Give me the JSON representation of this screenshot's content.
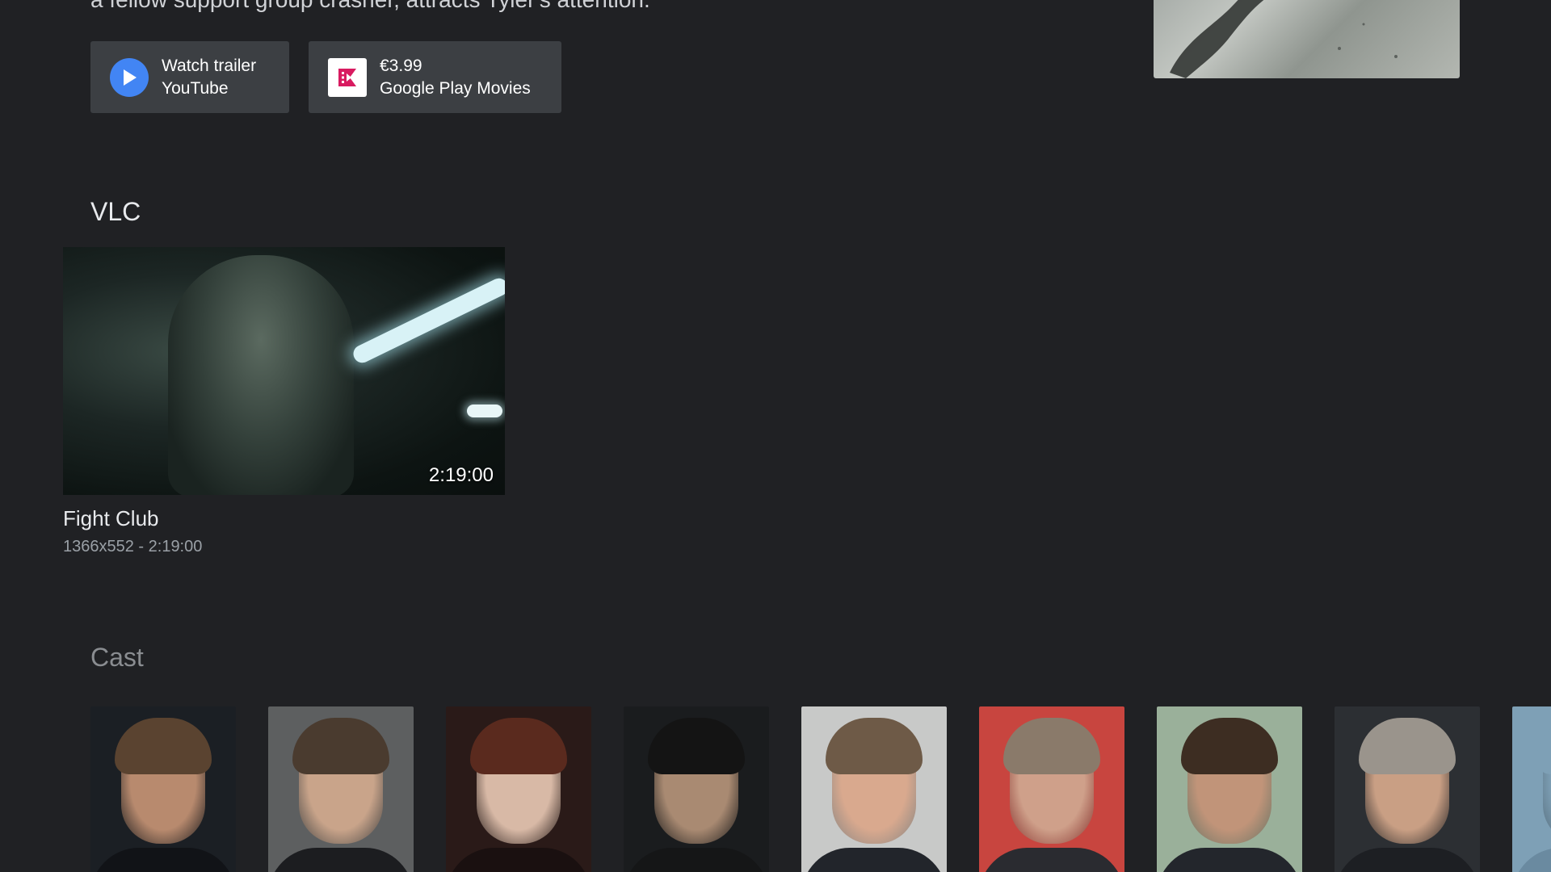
{
  "overview": {
    "synopsis_tail": "a fellow support group crasher, attracts Tyler's attention."
  },
  "actions": {
    "trailer": {
      "line1": "Watch trailer",
      "line2": "YouTube",
      "icon": "play-icon",
      "icon_color": "#4285f4"
    },
    "purchase": {
      "line1": "€3.99",
      "line2": "Google Play Movies",
      "icon": "google-play-movies-icon",
      "icon_color": "#d81b60"
    }
  },
  "vlc": {
    "title": "VLC",
    "video": {
      "duration": "2:19:00",
      "title": "Fight Club",
      "meta": "1366x552 - 2:19:00"
    }
  },
  "cast": {
    "title": "Cast",
    "members": [
      {
        "skin": "#b88a6e",
        "hair": "#5a4330",
        "bg": "#1b1f24",
        "shirt": "#111317"
      },
      {
        "skin": "#c9a48a",
        "hair": "#4a3b2f",
        "bg": "#5d5f60",
        "shirt": "#1c1d20"
      },
      {
        "skin": "#d8b9a6",
        "hair": "#5a2a1e",
        "bg": "#2a1a18",
        "shirt": "#1a1010"
      },
      {
        "skin": "#a98a72",
        "hair": "#141414",
        "bg": "#1a1c1e",
        "shirt": "#151617"
      },
      {
        "skin": "#d9a98e",
        "hair": "#6e5a47",
        "bg": "#c8c9c8",
        "shirt": "#22252b"
      },
      {
        "skin": "#cfa08a",
        "hair": "#8a7a6a",
        "bg": "#c8453f",
        "shirt": "#2a2b30"
      },
      {
        "skin": "#c19479",
        "hair": "#3d2d22",
        "bg": "#9ab09a",
        "shirt": "#23262c"
      },
      {
        "skin": "#c99f84",
        "hair": "#9a948c",
        "bg": "#2c2f33",
        "shirt": "#1d1f23"
      },
      {
        "skin": "#7ea0b6",
        "hair": "#7ea0b6",
        "bg": "#7ea0b6",
        "shirt": "#6a8aa0"
      }
    ]
  }
}
